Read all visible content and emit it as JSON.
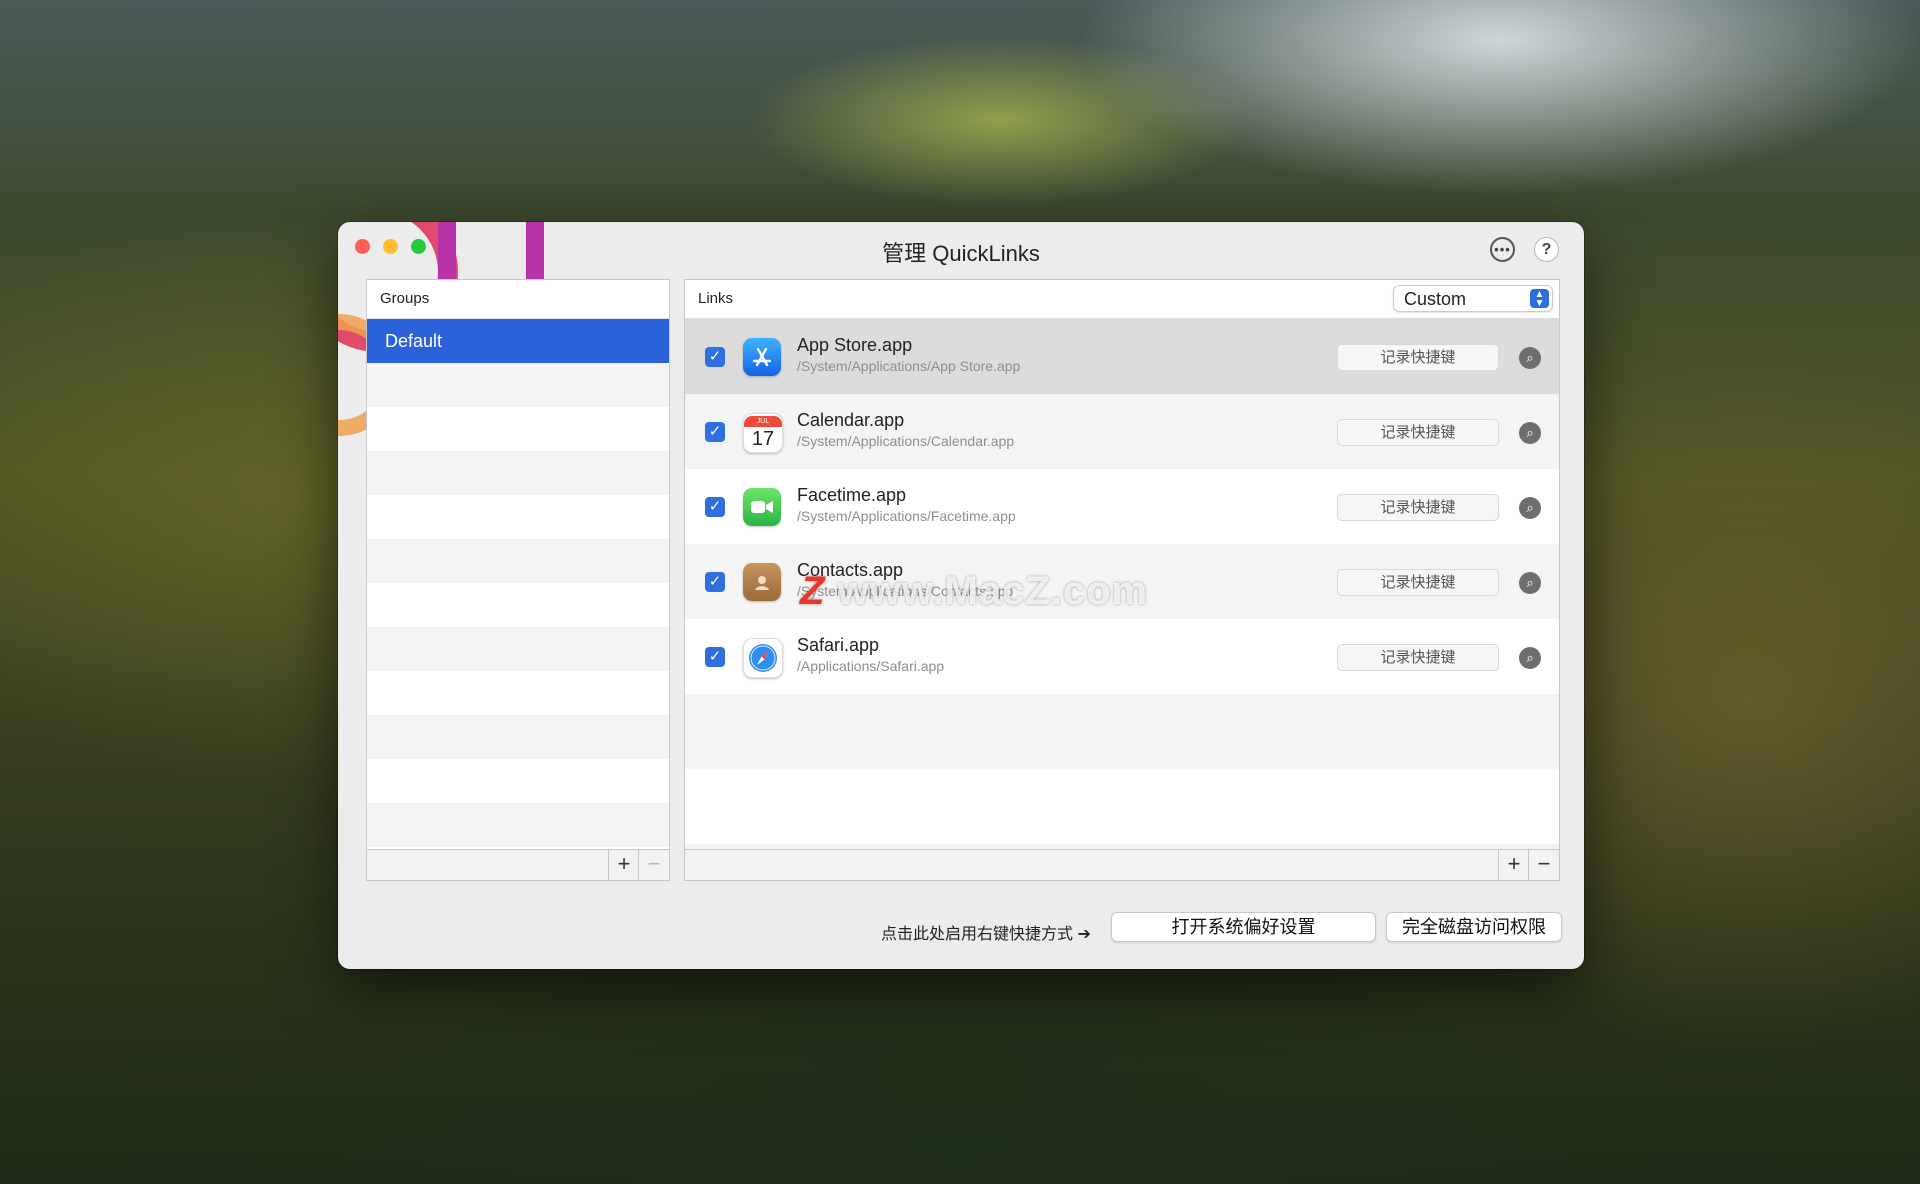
{
  "window": {
    "title": "管理 QuickLinks",
    "more_icon": "ellipsis-circle-icon",
    "help_label": "?"
  },
  "groups": {
    "header": "Groups",
    "items": [
      {
        "label": "Default",
        "selected": true
      }
    ],
    "add_label": "+",
    "remove_label": "−"
  },
  "links": {
    "header": "Links",
    "filter": {
      "selected": "Custom",
      "arrow": "⌃⌄"
    },
    "items": [
      {
        "name": "App Store.app",
        "path": "/System/Applications/App Store.app",
        "checked": true,
        "icon": "app-store-icon",
        "shortcut_label": "记录快捷键"
      },
      {
        "name": "Calendar.app",
        "path": "/System/Applications/Calendar.app",
        "checked": true,
        "icon": "calendar-icon",
        "shortcut_label": "记录快捷键",
        "icon_month": "JUL",
        "icon_day": "17"
      },
      {
        "name": "Facetime.app",
        "path": "/System/Applications/Facetime.app",
        "checked": true,
        "icon": "facetime-icon",
        "shortcut_label": "记录快捷键"
      },
      {
        "name": "Contacts.app",
        "path": "/System/Applications/Contacts.app",
        "checked": true,
        "icon": "contacts-icon",
        "shortcut_label": "记录快捷键"
      },
      {
        "name": "Safari.app",
        "path": "/Applications/Safari.app",
        "checked": true,
        "icon": "safari-icon",
        "shortcut_label": "记录快捷键"
      }
    ],
    "add_label": "+",
    "remove_label": "−"
  },
  "footer": {
    "hint": "点击此处启用右键快捷方式 ➔",
    "open_prefs_label": "打开系统偏好设置",
    "disk_access_label": "完全磁盘访问权限"
  },
  "watermark": {
    "z": "Z",
    "text": " www.MacZ.com"
  },
  "colors": {
    "accent": "#2b62d9",
    "close": "#ff5f57",
    "minimize": "#febc2e",
    "zoom": "#28c840"
  }
}
